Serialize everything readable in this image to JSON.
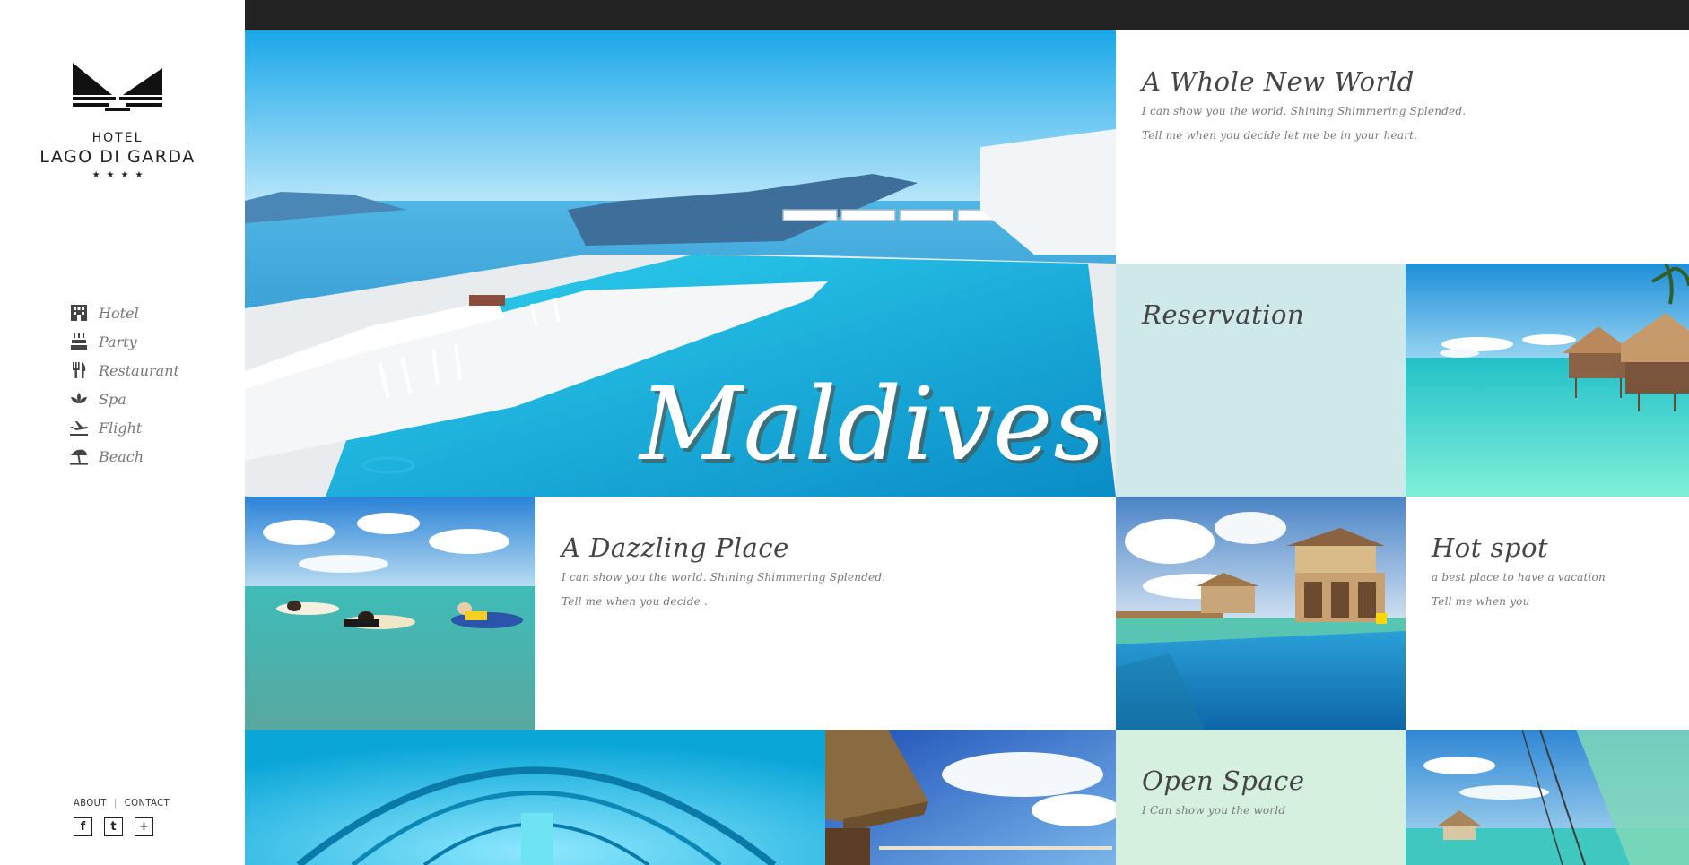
{
  "brand": {
    "line1": "HOTEL",
    "line2": "LAGO DI GARDA",
    "stars": "★★★★"
  },
  "nav": {
    "items": [
      {
        "label": "Hotel",
        "icon": "hotel-icon"
      },
      {
        "label": "Party",
        "icon": "cake-icon"
      },
      {
        "label": "Restaurant",
        "icon": "fork-knife-icon"
      },
      {
        "label": "Spa",
        "icon": "lotus-icon"
      },
      {
        "label": "Flight",
        "icon": "plane-icon"
      },
      {
        "label": "Beach",
        "icon": "umbrella-icon"
      }
    ]
  },
  "footer": {
    "about": "ABOUT",
    "contact": "CONTACT",
    "social": [
      {
        "name": "facebook-icon",
        "glyph": "f"
      },
      {
        "name": "twitter-icon",
        "glyph": "t"
      },
      {
        "name": "plus-icon",
        "glyph": "+"
      }
    ]
  },
  "hero": {
    "caption": "Maldives"
  },
  "tiles": {
    "whole_new_world": {
      "title": "A Whole New World",
      "line1": "I can show you the world. Shining Shimmering Splended.",
      "line2": "Tell me when you decide let me be in your heart."
    },
    "reservation": {
      "title": "Reservation",
      "bg": "#cfe9ea"
    },
    "dazzling_place": {
      "title": "A Dazzling Place",
      "line1": "I can show you the world. Shining Shimmering Splended.",
      "line2": "Tell me when you decide ."
    },
    "hot_spot": {
      "title": "Hot spot",
      "line1": "a best place to have a vacation",
      "line2": "Tell me when you"
    },
    "open_space": {
      "title": "Open Space",
      "line1": "I Can show you the world",
      "bg": "#d6f0e0"
    }
  },
  "colors": {
    "topbar": "#222222",
    "text": "#555555"
  }
}
